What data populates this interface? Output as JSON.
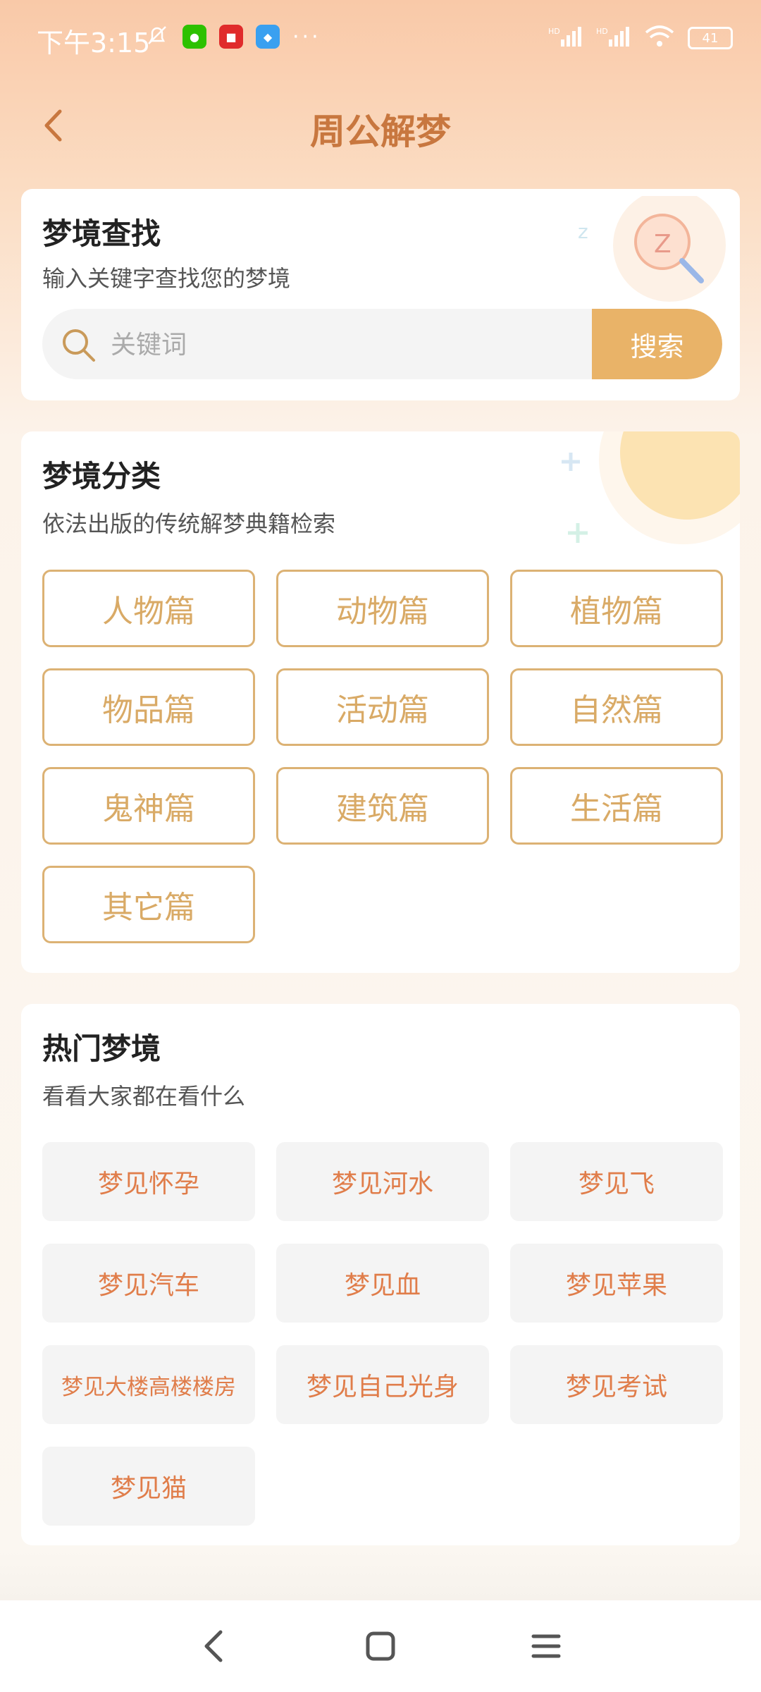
{
  "status_bar": {
    "time": "下午3:15",
    "icons": [
      "mute-bell-icon",
      "wechat-icon",
      "news-app-icon",
      "app-icon",
      "more-dots-icon"
    ],
    "right_icons": [
      "hd-signal-icon",
      "hd-signal-icon",
      "wifi-icon",
      "battery-icon"
    ],
    "battery": "41"
  },
  "header": {
    "title": "周公解梦",
    "back_icon": "chevron-left-icon"
  },
  "search_card": {
    "title": "梦境查找",
    "subtitle": "输入关键字查找您的梦境",
    "input_placeholder": "关键词",
    "input_value": "",
    "button_label": "搜索"
  },
  "category_card": {
    "title": "梦境分类",
    "subtitle": "依法出版的传统解梦典籍检索",
    "items": [
      "人物篇",
      "动物篇",
      "植物篇",
      "物品篇",
      "活动篇",
      "自然篇",
      "鬼神篇",
      "建筑篇",
      "生活篇",
      "其它篇"
    ]
  },
  "hot_card": {
    "title": "热门梦境",
    "subtitle": "看看大家都在看什么",
    "items": [
      "梦见怀孕",
      "梦见河水",
      "梦见飞",
      "梦见汽车",
      "梦见血",
      "梦见苹果",
      "梦见大楼高楼楼房",
      "梦见自己光身",
      "梦见考试",
      "梦见猫"
    ]
  },
  "colors": {
    "accent": "#e9b368",
    "title": "#c8773f",
    "category_text": "#d9aa66",
    "hot_text": "#e07d4a"
  },
  "nav_bar": {
    "icons": [
      "back-triangle-icon",
      "home-square-icon",
      "menu-lines-icon"
    ]
  }
}
